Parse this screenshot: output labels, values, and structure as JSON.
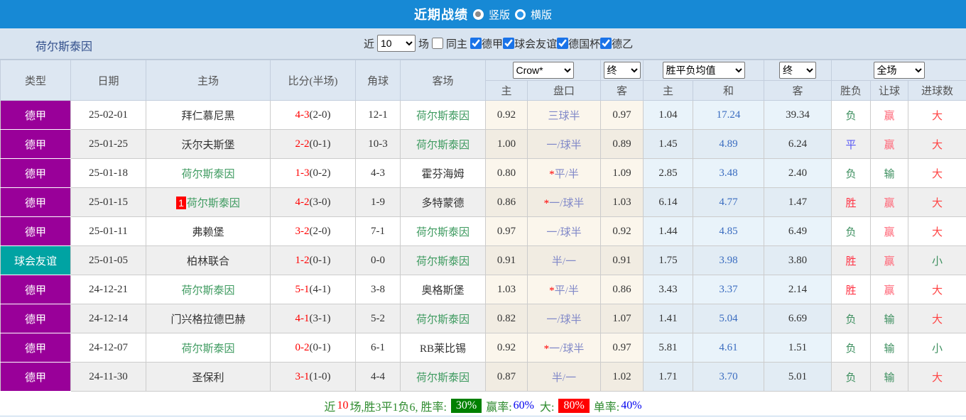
{
  "topbar": {
    "title": "近期战绩",
    "radios": [
      {
        "label": "竖版",
        "selected": false
      },
      {
        "label": "横版",
        "selected": true
      }
    ]
  },
  "filterbar": {
    "team": "荷尔斯泰因",
    "near_label": "近",
    "count_value": "10",
    "games_label": "场",
    "same_home_label": "同主",
    "same_home_checked": false,
    "leagues": [
      {
        "label": "德甲",
        "checked": true
      },
      {
        "label": "球会友谊",
        "checked": true
      },
      {
        "label": "德国杯",
        "checked": true
      },
      {
        "label": "德乙",
        "checked": true
      }
    ]
  },
  "table": {
    "left_headers": [
      "类型",
      "日期",
      "主场",
      "比分(半场)",
      "角球",
      "客场"
    ],
    "selects": {
      "company": "Crow*",
      "company_state": "终",
      "avg": "胜平负均值",
      "avg_state": "终",
      "scope": "全场"
    },
    "sub_headers": [
      "主",
      "盘口",
      "客",
      "主",
      "和",
      "客",
      "胜负",
      "让球",
      "进球数"
    ],
    "rows": [
      {
        "type": "德甲",
        "type_k": "league",
        "date": "25-02-01",
        "home": "拜仁慕尼黑",
        "home_focus": false,
        "badge": "",
        "score": "4-3",
        "half": "(2-0)",
        "corner": "12-1",
        "away": "荷尔斯泰因",
        "away_focus": true,
        "o_home": "0.92",
        "star": false,
        "handicap": "三球半",
        "o_away": "0.97",
        "a_home": "1.04",
        "a_draw": "17.24",
        "a_away": "39.34",
        "res": "负",
        "res_k": "lose",
        "let": "赢",
        "let_k": "win",
        "goal": "大",
        "goal_k": "big"
      },
      {
        "type": "德甲",
        "type_k": "league",
        "date": "25-01-25",
        "home": "沃尔夫斯堡",
        "home_focus": false,
        "badge": "",
        "score": "2-2",
        "half": "(0-1)",
        "corner": "10-3",
        "away": "荷尔斯泰因",
        "away_focus": true,
        "o_home": "1.00",
        "star": false,
        "handicap": "一/球半",
        "o_away": "0.89",
        "a_home": "1.45",
        "a_draw": "4.89",
        "a_away": "6.24",
        "res": "平",
        "res_k": "draw",
        "let": "赢",
        "let_k": "win",
        "goal": "大",
        "goal_k": "big"
      },
      {
        "type": "德甲",
        "type_k": "league",
        "date": "25-01-18",
        "home": "荷尔斯泰因",
        "home_focus": true,
        "badge": "",
        "score": "1-3",
        "half": "(0-2)",
        "corner": "4-3",
        "away": "霍芬海姆",
        "away_focus": false,
        "o_home": "0.80",
        "star": true,
        "handicap": "平/半",
        "o_away": "1.09",
        "a_home": "2.85",
        "a_draw": "3.48",
        "a_away": "2.40",
        "res": "负",
        "res_k": "lose",
        "let": "输",
        "let_k": "lose",
        "goal": "大",
        "goal_k": "big"
      },
      {
        "type": "德甲",
        "type_k": "league",
        "date": "25-01-15",
        "home": "荷尔斯泰因",
        "home_focus": true,
        "badge": "1",
        "score": "4-2",
        "half": "(3-0)",
        "corner": "1-9",
        "away": "多特蒙德",
        "away_focus": false,
        "o_home": "0.86",
        "star": true,
        "handicap": "一/球半",
        "o_away": "1.03",
        "a_home": "6.14",
        "a_draw": "4.77",
        "a_away": "1.47",
        "res": "胜",
        "res_k": "win",
        "let": "赢",
        "let_k": "win",
        "goal": "大",
        "goal_k": "big"
      },
      {
        "type": "德甲",
        "type_k": "league",
        "date": "25-01-11",
        "home": "弗赖堡",
        "home_focus": false,
        "badge": "",
        "score": "3-2",
        "half": "(2-0)",
        "corner": "7-1",
        "away": "荷尔斯泰因",
        "away_focus": true,
        "o_home": "0.97",
        "star": false,
        "handicap": "一/球半",
        "o_away": "0.92",
        "a_home": "1.44",
        "a_draw": "4.85",
        "a_away": "6.49",
        "res": "负",
        "res_k": "lose",
        "let": "赢",
        "let_k": "win",
        "goal": "大",
        "goal_k": "big"
      },
      {
        "type": "球会友谊",
        "type_k": "friendly",
        "date": "25-01-05",
        "home": "柏林联合",
        "home_focus": false,
        "badge": "",
        "score": "1-2",
        "half": "(0-1)",
        "corner": "0-0",
        "away": "荷尔斯泰因",
        "away_focus": true,
        "o_home": "0.91",
        "star": false,
        "handicap": "半/一",
        "o_away": "0.91",
        "a_home": "1.75",
        "a_draw": "3.98",
        "a_away": "3.80",
        "res": "胜",
        "res_k": "win",
        "let": "赢",
        "let_k": "win",
        "goal": "小",
        "goal_k": "small"
      },
      {
        "type": "德甲",
        "type_k": "league",
        "date": "24-12-21",
        "home": "荷尔斯泰因",
        "home_focus": true,
        "badge": "",
        "score": "5-1",
        "half": "(4-1)",
        "corner": "3-8",
        "away": "奥格斯堡",
        "away_focus": false,
        "o_home": "1.03",
        "star": true,
        "handicap": "平/半",
        "o_away": "0.86",
        "a_home": "3.43",
        "a_draw": "3.37",
        "a_away": "2.14",
        "res": "胜",
        "res_k": "win",
        "let": "赢",
        "let_k": "win",
        "goal": "大",
        "goal_k": "big"
      },
      {
        "type": "德甲",
        "type_k": "league",
        "date": "24-12-14",
        "home": "门兴格拉德巴赫",
        "home_focus": false,
        "badge": "",
        "score": "4-1",
        "half": "(3-1)",
        "corner": "5-2",
        "away": "荷尔斯泰因",
        "away_focus": true,
        "o_home": "0.82",
        "star": false,
        "handicap": "一/球半",
        "o_away": "1.07",
        "a_home": "1.41",
        "a_draw": "5.04",
        "a_away": "6.69",
        "res": "负",
        "res_k": "lose",
        "let": "输",
        "let_k": "lose",
        "goal": "大",
        "goal_k": "big"
      },
      {
        "type": "德甲",
        "type_k": "league",
        "date": "24-12-07",
        "home": "荷尔斯泰因",
        "home_focus": true,
        "badge": "",
        "score": "0-2",
        "half": "(0-1)",
        "corner": "6-1",
        "away": "RB莱比锡",
        "away_focus": false,
        "o_home": "0.92",
        "star": true,
        "handicap": "一/球半",
        "o_away": "0.97",
        "a_home": "5.81",
        "a_draw": "4.61",
        "a_away": "1.51",
        "res": "负",
        "res_k": "lose",
        "let": "输",
        "let_k": "lose",
        "goal": "小",
        "goal_k": "small"
      },
      {
        "type": "德甲",
        "type_k": "league",
        "date": "24-11-30",
        "home": "圣保利",
        "home_focus": false,
        "badge": "",
        "score": "3-1",
        "half": "(1-0)",
        "corner": "4-4",
        "away": "荷尔斯泰因",
        "away_focus": true,
        "o_home": "0.87",
        "star": false,
        "handicap": "半/一",
        "o_away": "1.02",
        "a_home": "1.71",
        "a_draw": "3.70",
        "a_away": "5.01",
        "res": "负",
        "res_k": "lose",
        "let": "输",
        "let_k": "lose",
        "goal": "大",
        "goal_k": "big"
      }
    ]
  },
  "footer": {
    "near_label": "近",
    "count": "10",
    "summary": "场,胜3平1负6, 胜率:",
    "win_rate": "30%",
    "let_label": "赢率:",
    "let_rate": "60%",
    "big_label": "大:",
    "big_rate": "80%",
    "single_label": "单率:",
    "single_rate": "40%"
  },
  "colors": {
    "topbar_blue": "#1789d5",
    "filterbar_bg": "#d9e4f0",
    "header_bg": "#dde7f2",
    "league_purple": "#990099",
    "friendly_teal": "#00a3a3",
    "focus_team_green": "#3d9a5f",
    "score_red": "#ff0000",
    "handicap_slate_blue": "#8088c8",
    "avg_draw_blue": "#3a6cc0",
    "win_red": "#ff3344",
    "draw_blue": "#5a5af5",
    "lose_green": "#3d8f5f",
    "rate_green_bg": "#008000",
    "rate_red_bg": "#ff0000",
    "rate_blue_text": "#0000ee",
    "footer_green": "#2e8b2e"
  }
}
